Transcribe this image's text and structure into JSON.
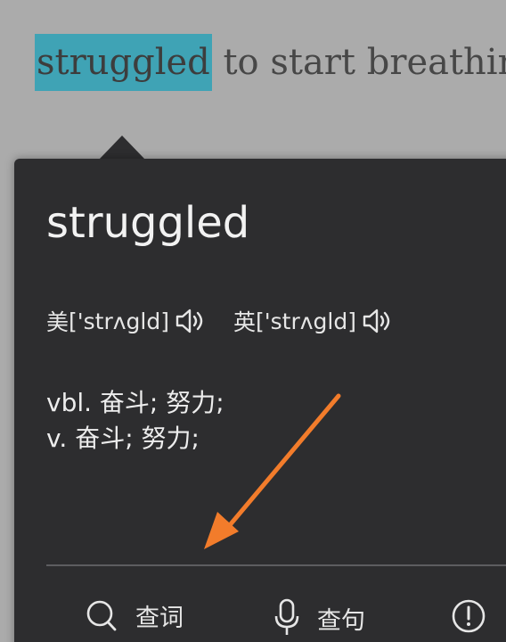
{
  "reading": {
    "highlighted_word": "struggled",
    "line_rest": " to start breathin"
  },
  "popup": {
    "word": "struggled",
    "phonetics": [
      {
        "region": "美",
        "ipa": "['strʌgld]",
        "icon": "speaker-icon"
      },
      {
        "region": "英",
        "ipa": "['strʌgld]",
        "icon": "speaker-icon"
      }
    ],
    "definitions": [
      "vbl. 奋斗; 努力;",
      "v. 奋斗; 努力;"
    ],
    "toolbar": {
      "lookup_word": {
        "label": "查词",
        "icon": "search-icon"
      },
      "lookup_sentence": {
        "label": "查句",
        "icon": "microphone-icon"
      },
      "report": {
        "label": "",
        "icon": "info-icon"
      }
    }
  },
  "colors": {
    "highlight": "#3fa3b5",
    "popup_bg": "#2d2d2f",
    "annotation_arrow": "#f27c2b"
  }
}
